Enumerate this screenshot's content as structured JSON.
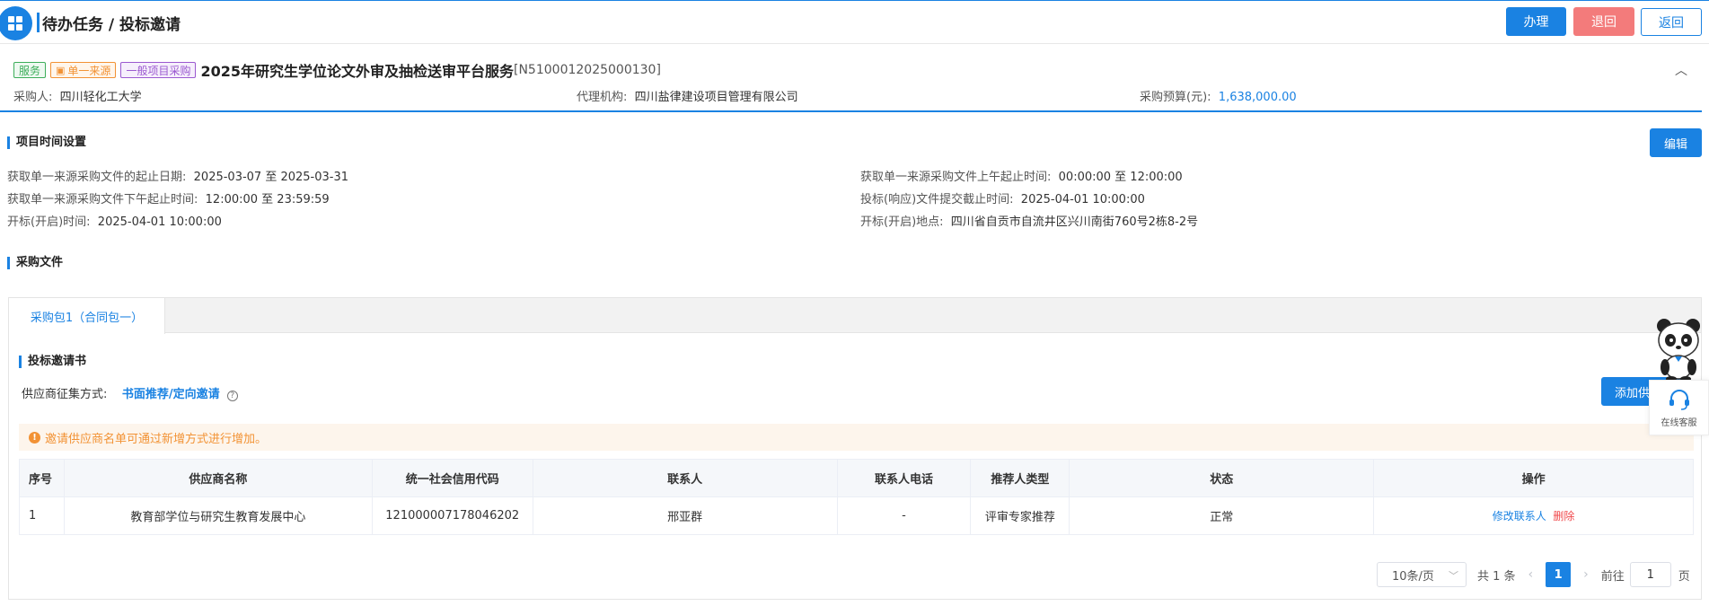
{
  "header": {
    "title": "待办任务 / 投标邀请",
    "buttons": {
      "handle": "办理",
      "reject": "退回",
      "back": "返回"
    }
  },
  "project": {
    "tags": [
      "服务",
      "单一来源",
      "一般项目采购"
    ],
    "name": "2025年研究生学位论文外审及抽检送审平台服务",
    "code": "[N5100012025000130]",
    "purchaser_label": "采购人:",
    "purchaser": "四川轻化工大学",
    "agency_label": "代理机构:",
    "agency": "四川盐律建设项目管理有限公司",
    "budget_label": "采购预算(元):",
    "budget": "1,638,000.00"
  },
  "time_settings": {
    "title": "项目时间设置",
    "edit_label": "编辑",
    "fields": [
      {
        "label": "获取单一来源采购文件的起止日期:",
        "value": "2025-03-07 至 2025-03-31"
      },
      {
        "label": "获取单一来源采购文件上午起止时间:",
        "value": "00:00:00 至 12:00:00"
      },
      {
        "label": "获取单一来源采购文件下午起止时间:",
        "value": "12:00:00 至 23:59:59"
      },
      {
        "label": "投标(响应)文件提交截止时间:",
        "value": "2025-04-01 10:00:00"
      },
      {
        "label": "开标(开启)时间:",
        "value": "2025-04-01 10:00:00"
      },
      {
        "label": "开标(开启)地点:",
        "value": "四川省自贡市自流井区兴川南街760号2栋8-2号"
      }
    ]
  },
  "docs": {
    "title": "采购文件",
    "tab": "采购包1（合同包一）",
    "invite_title": "投标邀请书",
    "method_label": "供应商征集方式:",
    "method_value": "书面推荐/定向邀请",
    "add_button": "添加供",
    "notice": "邀请供应商名单可通过新增方式进行增加。",
    "columns": [
      "序号",
      "供应商名称",
      "统一社会信用代码",
      "联系人",
      "联系人电话",
      "推荐人类型",
      "状态",
      "操作"
    ],
    "rows": [
      {
        "index": "1",
        "name": "教育部学位与研究生教育发展中心",
        "credit_code": "121000007178046202",
        "contact": "邢亚群",
        "phone": "-",
        "recommender_type": "评审专家推荐",
        "status": "正常",
        "actions": {
          "edit": "修改联系人",
          "delete": "删除"
        }
      }
    ]
  },
  "pagination": {
    "page_size": "10条/页",
    "total": "共 1 条",
    "current_page": "1",
    "goto_label": "前往",
    "goto_value": "1",
    "page_unit": "页"
  },
  "widget": {
    "label": "在线客服"
  }
}
